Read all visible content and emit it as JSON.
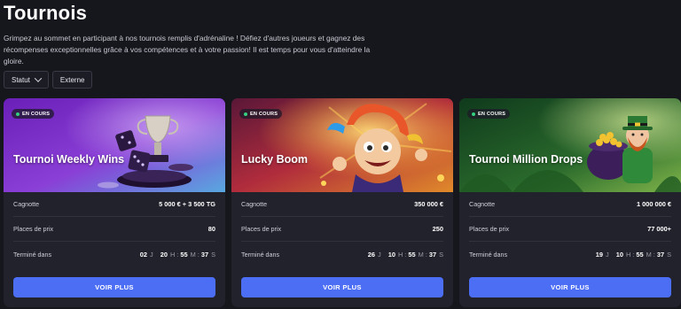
{
  "page": {
    "title": "Tournois",
    "intro": "Grimpez au sommet en participant à nos tournois remplis d'adrénaline ! Défiez d'autres joueurs et gagnez des récompenses exceptionnelles grâce à vos compétences et à votre passion! Il est temps pour vous d'atteindre la gloire."
  },
  "filters": {
    "status_label": "Statut",
    "external_label": "Externe"
  },
  "labels": {
    "prize_pool": "Cagnotte",
    "prize_places": "Places de prix",
    "ends_in": "Terminé dans",
    "cta": "VOIR PLUS",
    "unit_days": "J",
    "unit_hours": "H",
    "unit_minutes": "M",
    "unit_seconds": "S"
  },
  "colors": {
    "accent": "#4c6ef5",
    "live": "#35d07f",
    "background": "#16161d",
    "card": "#22222c"
  },
  "tournaments": [
    {
      "status": "EN COURS",
      "title": "Tournoi Weekly Wins",
      "prize_pool": "5 000 € + 3 500 TG",
      "prize_places": "80",
      "days": "02",
      "hours": "20",
      "minutes": "55",
      "seconds": "37",
      "banner_icon": "trophy-dice-icon"
    },
    {
      "status": "EN COURS",
      "title": "Lucky Boom",
      "prize_pool": "350 000 €",
      "prize_places": "250",
      "days": "26",
      "hours": "10",
      "minutes": "55",
      "seconds": "37",
      "banner_icon": "jester-icon"
    },
    {
      "status": "EN COURS",
      "title": "Tournoi Million Drops",
      "prize_pool": "1 000 000 €",
      "prize_places": "77 000+",
      "days": "19",
      "hours": "10",
      "minutes": "55",
      "seconds": "37",
      "banner_icon": "leprechaun-icon"
    }
  ]
}
